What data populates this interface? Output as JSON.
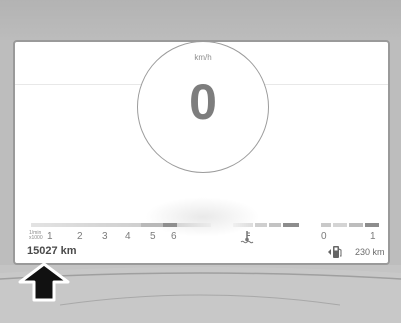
{
  "speed": {
    "value": "0",
    "unit": "km/h"
  },
  "tacho": {
    "unit_label": "1/min x1000",
    "ticks": [
      "1",
      "2",
      "3",
      "4",
      "5",
      "6"
    ]
  },
  "odometer": {
    "value": "15027 km"
  },
  "fuel": {
    "empty": "0",
    "full": "1",
    "range": "230 km"
  },
  "icons": [
    "coolant-temperature-icon",
    "fuel-pump-icon",
    "pointer-arrow"
  ],
  "colors": {
    "screen": "#ffffff",
    "frame": "#bdbdbd",
    "arrow": "#111111"
  }
}
